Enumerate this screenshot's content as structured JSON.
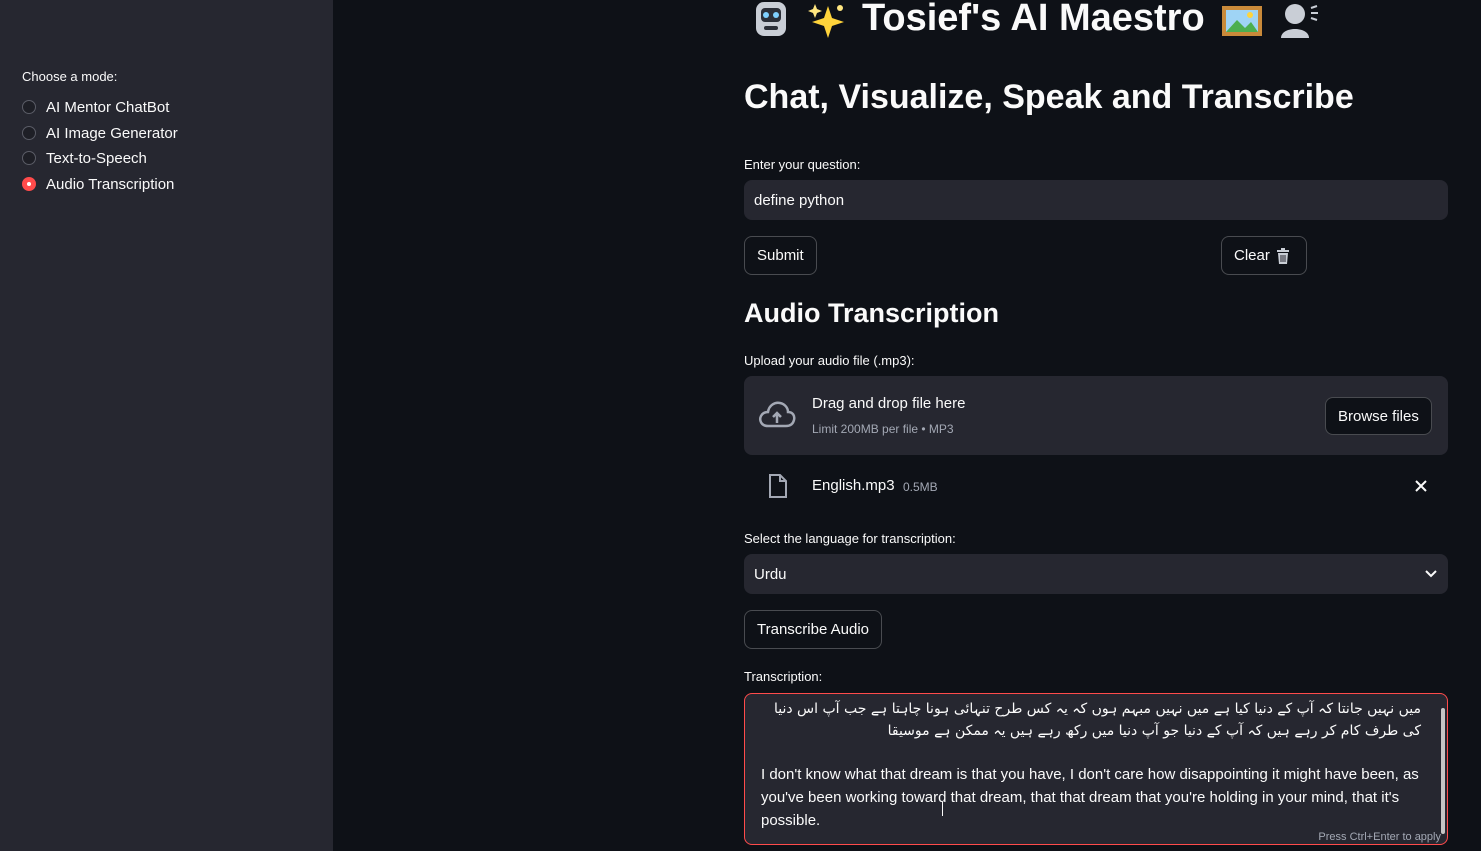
{
  "sidebar": {
    "mode_label": "Choose a mode:",
    "modes": [
      {
        "label": "AI Mentor ChatBot",
        "selected": false
      },
      {
        "label": "AI Image Generator",
        "selected": false
      },
      {
        "label": "Text-to-Speech",
        "selected": false
      },
      {
        "label": "Audio Transcription",
        "selected": true
      }
    ]
  },
  "header": {
    "title": "Tosief's AI Maestro",
    "icons": [
      "robot-emoji-icon",
      "sparkles-emoji-icon",
      "framed-picture-emoji-icon",
      "speaking-head-emoji-icon"
    ]
  },
  "chat": {
    "heading": "Chat, Visualize, Speak and Transcribe",
    "question_label": "Enter your question:",
    "question_value": "define python",
    "submit_label": "Submit",
    "clear_label": "Clear",
    "clear_icon": "wastebasket-icon"
  },
  "transcription": {
    "heading": "Audio Transcription",
    "upload_label": "Upload your audio file (.mp3):",
    "dropzone_title": "Drag and drop file here",
    "dropzone_subtitle": "Limit 200MB per file • MP3",
    "browse_label": "Browse files",
    "file_name": "English.mp3",
    "file_size": "0.5MB",
    "language_label": "Select the language for transcription:",
    "language_value": "Urdu",
    "transcribe_label": "Transcribe Audio",
    "result_label": "Transcription:",
    "result_urdu": "میں نہیں جانتا کہ آپ کے دنیا کیا ہے میں نہیں مبہم ہوں کہ یہ کس طرح تنہائی ہونا چاہتا ہے جب آپ اس دنیا کی طرف کام کر رہے ہیں کہ آپ کے دنیا جو آپ دنیا میں رکھ رہے ہیں یہ ممکن ہے موسیقا",
    "result_english": "I don't know what that dream is that you have, I don't care how disappointing it might have been, as you've been working toward that dream, that that dream that you're holding in your mind, that it's possible.",
    "hint": "Press Ctrl+Enter to apply"
  },
  "colors": {
    "background": "#0e1117",
    "sidebar": "#262730",
    "accent": "#ff4b4b",
    "input_bg": "#262730"
  }
}
